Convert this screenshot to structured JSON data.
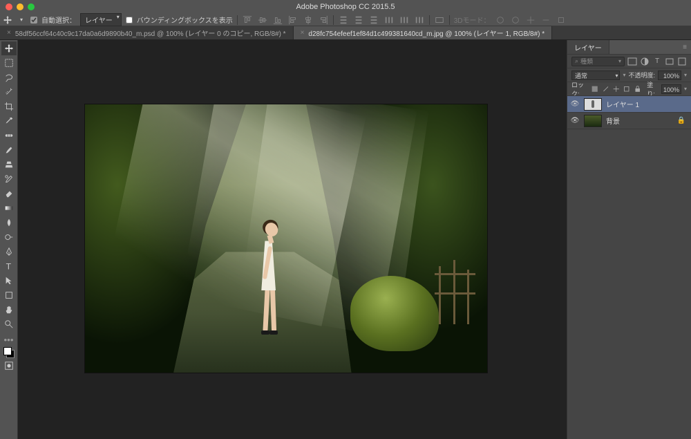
{
  "app": {
    "title": "Adobe Photoshop CC 2015.5"
  },
  "options": {
    "auto_select_label": "自動選択：",
    "auto_select_mode": "レイヤー",
    "bbox_label": "バウンディングボックスを表示",
    "threeD_label": "3Dモード："
  },
  "tabs": [
    {
      "label": "58df56ccf64c40c9c17da0a6d9890b40_m.psd @ 100% (レイヤー 0 のコピー, RGB/8#) *",
      "active": false
    },
    {
      "label": "d28fc754efeef1ef84d1c499381640cd_m.jpg @ 100% (レイヤー 1, RGB/8#) *",
      "active": true
    }
  ],
  "layersPanel": {
    "title": "レイヤー",
    "search_placeholder": "種類",
    "blend_mode": "通常",
    "opacity_label": "不透明度:",
    "opacity_value": "100%",
    "lock_label": "ロック:",
    "fill_label": "塗り:",
    "fill_value": "100%",
    "layers": [
      {
        "name": "レイヤー 1",
        "selected": true,
        "thumb": "figure",
        "locked": false
      },
      {
        "name": "背景",
        "selected": false,
        "thumb": "forest",
        "locked": true
      }
    ]
  }
}
